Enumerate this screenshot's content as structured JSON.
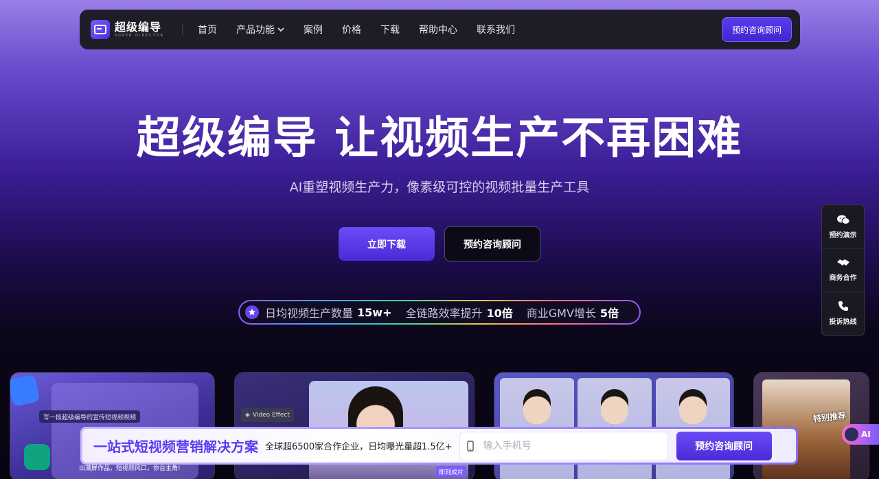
{
  "nav": {
    "logo_title": "超级编导",
    "logo_sub": "SUPER DIRECTOR",
    "links": [
      "首页",
      "产品功能",
      "案例",
      "价格",
      "下载",
      "帮助中心",
      "联系我们"
    ],
    "cta": "预约咨询顾问"
  },
  "hero": {
    "title": "超级编导 让视频生产不再困难",
    "subtitle": "AI重塑视频生产力，像素级可控的视频批量生产工具",
    "primary_button": "立即下载",
    "secondary_button": "预约咨询顾问"
  },
  "stats": [
    {
      "label": "日均视频生产数量",
      "value": "15w+"
    },
    {
      "label": "全链路效率提升",
      "value": "10倍"
    },
    {
      "label": "商业GMV增长",
      "value": "5倍"
    }
  ],
  "side_panel": [
    {
      "label": "预约演示",
      "icon": "wechat-icon"
    },
    {
      "label": "商务合作",
      "icon": "handshake-icon"
    },
    {
      "label": "投诉热线",
      "icon": "phone-icon"
    }
  ],
  "cards": {
    "card1_prompt": "写一段超级编导的宣传短视频视频",
    "card1_caption": "出潮屏作品，短视频风口，你台主角!",
    "card2_tag": "Video Effect",
    "card2_badge": "即刻成片",
    "card4_badge": "特别推荐"
  },
  "bottom_bar": {
    "title": "一站式短视频营销解决方案",
    "description": "全球超6500家合作企业，日均曝光量超1.5亿+",
    "phone_placeholder": "输入手机号",
    "cta": "预约咨询顾问"
  },
  "ai_bubble": "AI"
}
